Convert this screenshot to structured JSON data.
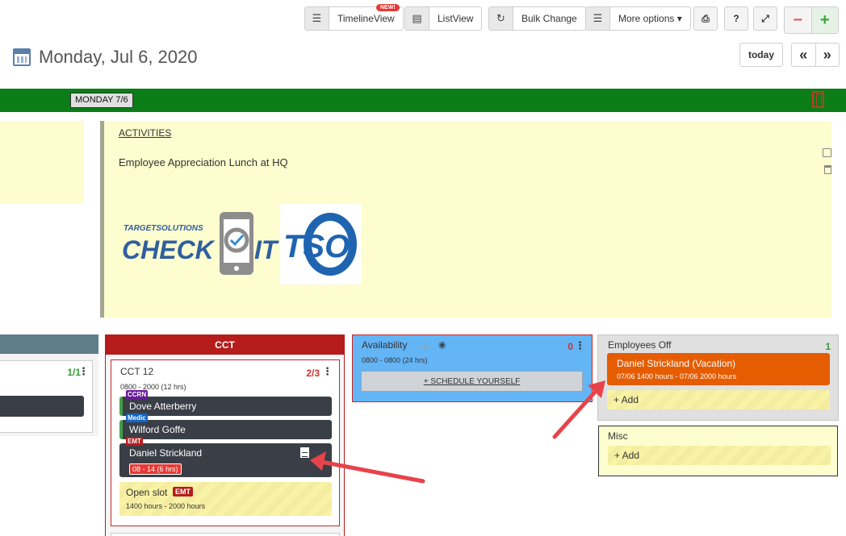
{
  "toolbar": {
    "timeline_label": "TimelineView",
    "new_badge": "NEW!",
    "list_label": "ListView",
    "bulk_label": "Bulk Change",
    "more_label": "More options",
    "help_label": "?",
    "zoom_out_label": "−",
    "zoom_in_label": "+"
  },
  "header": {
    "date_title": "Monday, Jul 6, 2020",
    "today_label": "today",
    "prev_label": "«",
    "next_label": "»"
  },
  "day_bar": {
    "day_label": "MONDAY 7/6"
  },
  "activities": {
    "heading": "ACTIVITIES",
    "text": "Employee Appreciation Lunch at HQ"
  },
  "logos": {
    "checkit_top": "TARGETSOLUTIONS",
    "checkit_left": "CHECK",
    "checkit_right": "IT",
    "tso": "TSO"
  },
  "left_column": {
    "count": "1/1"
  },
  "cct_column": {
    "title": "CCT",
    "unit": {
      "name": "CCT 12",
      "count": "2/3",
      "hours": "0800 - 2000 (12 hrs)",
      "staff": [
        {
          "tag": "CCRN",
          "name": "Dove Atterberry"
        },
        {
          "tag": "Medic",
          "name": "Wilford Goffe"
        },
        {
          "tag": "EMT",
          "name": "Daniel Strickland",
          "hours": "08 - 14 (6 hrs)"
        }
      ],
      "open_slot": {
        "label": "Open slot",
        "tag": "EMT",
        "hours": "1400 hours - 2000 hours"
      }
    }
  },
  "availability": {
    "title": "Availability",
    "count": "0",
    "hours": "0800 - 0800 (24 hrs)",
    "schedule_label": "+ SCHEDULE YOURSELF"
  },
  "employees_off": {
    "title": "Employees Off",
    "count": "1",
    "entry_name": "Daniel Strickland (Vacation)",
    "entry_dates": "07/06 1400 hours - 07/06 2000 hours",
    "add_label": "+ Add"
  },
  "misc": {
    "title": "Misc",
    "add_label": "+ Add"
  },
  "colors": {
    "green_bar": "#0a7d16",
    "cct_red": "#b71c1c",
    "availability_blue": "#64b5f6",
    "vacation_orange": "#e65c00",
    "annotation_arrow": "#e8434b"
  }
}
